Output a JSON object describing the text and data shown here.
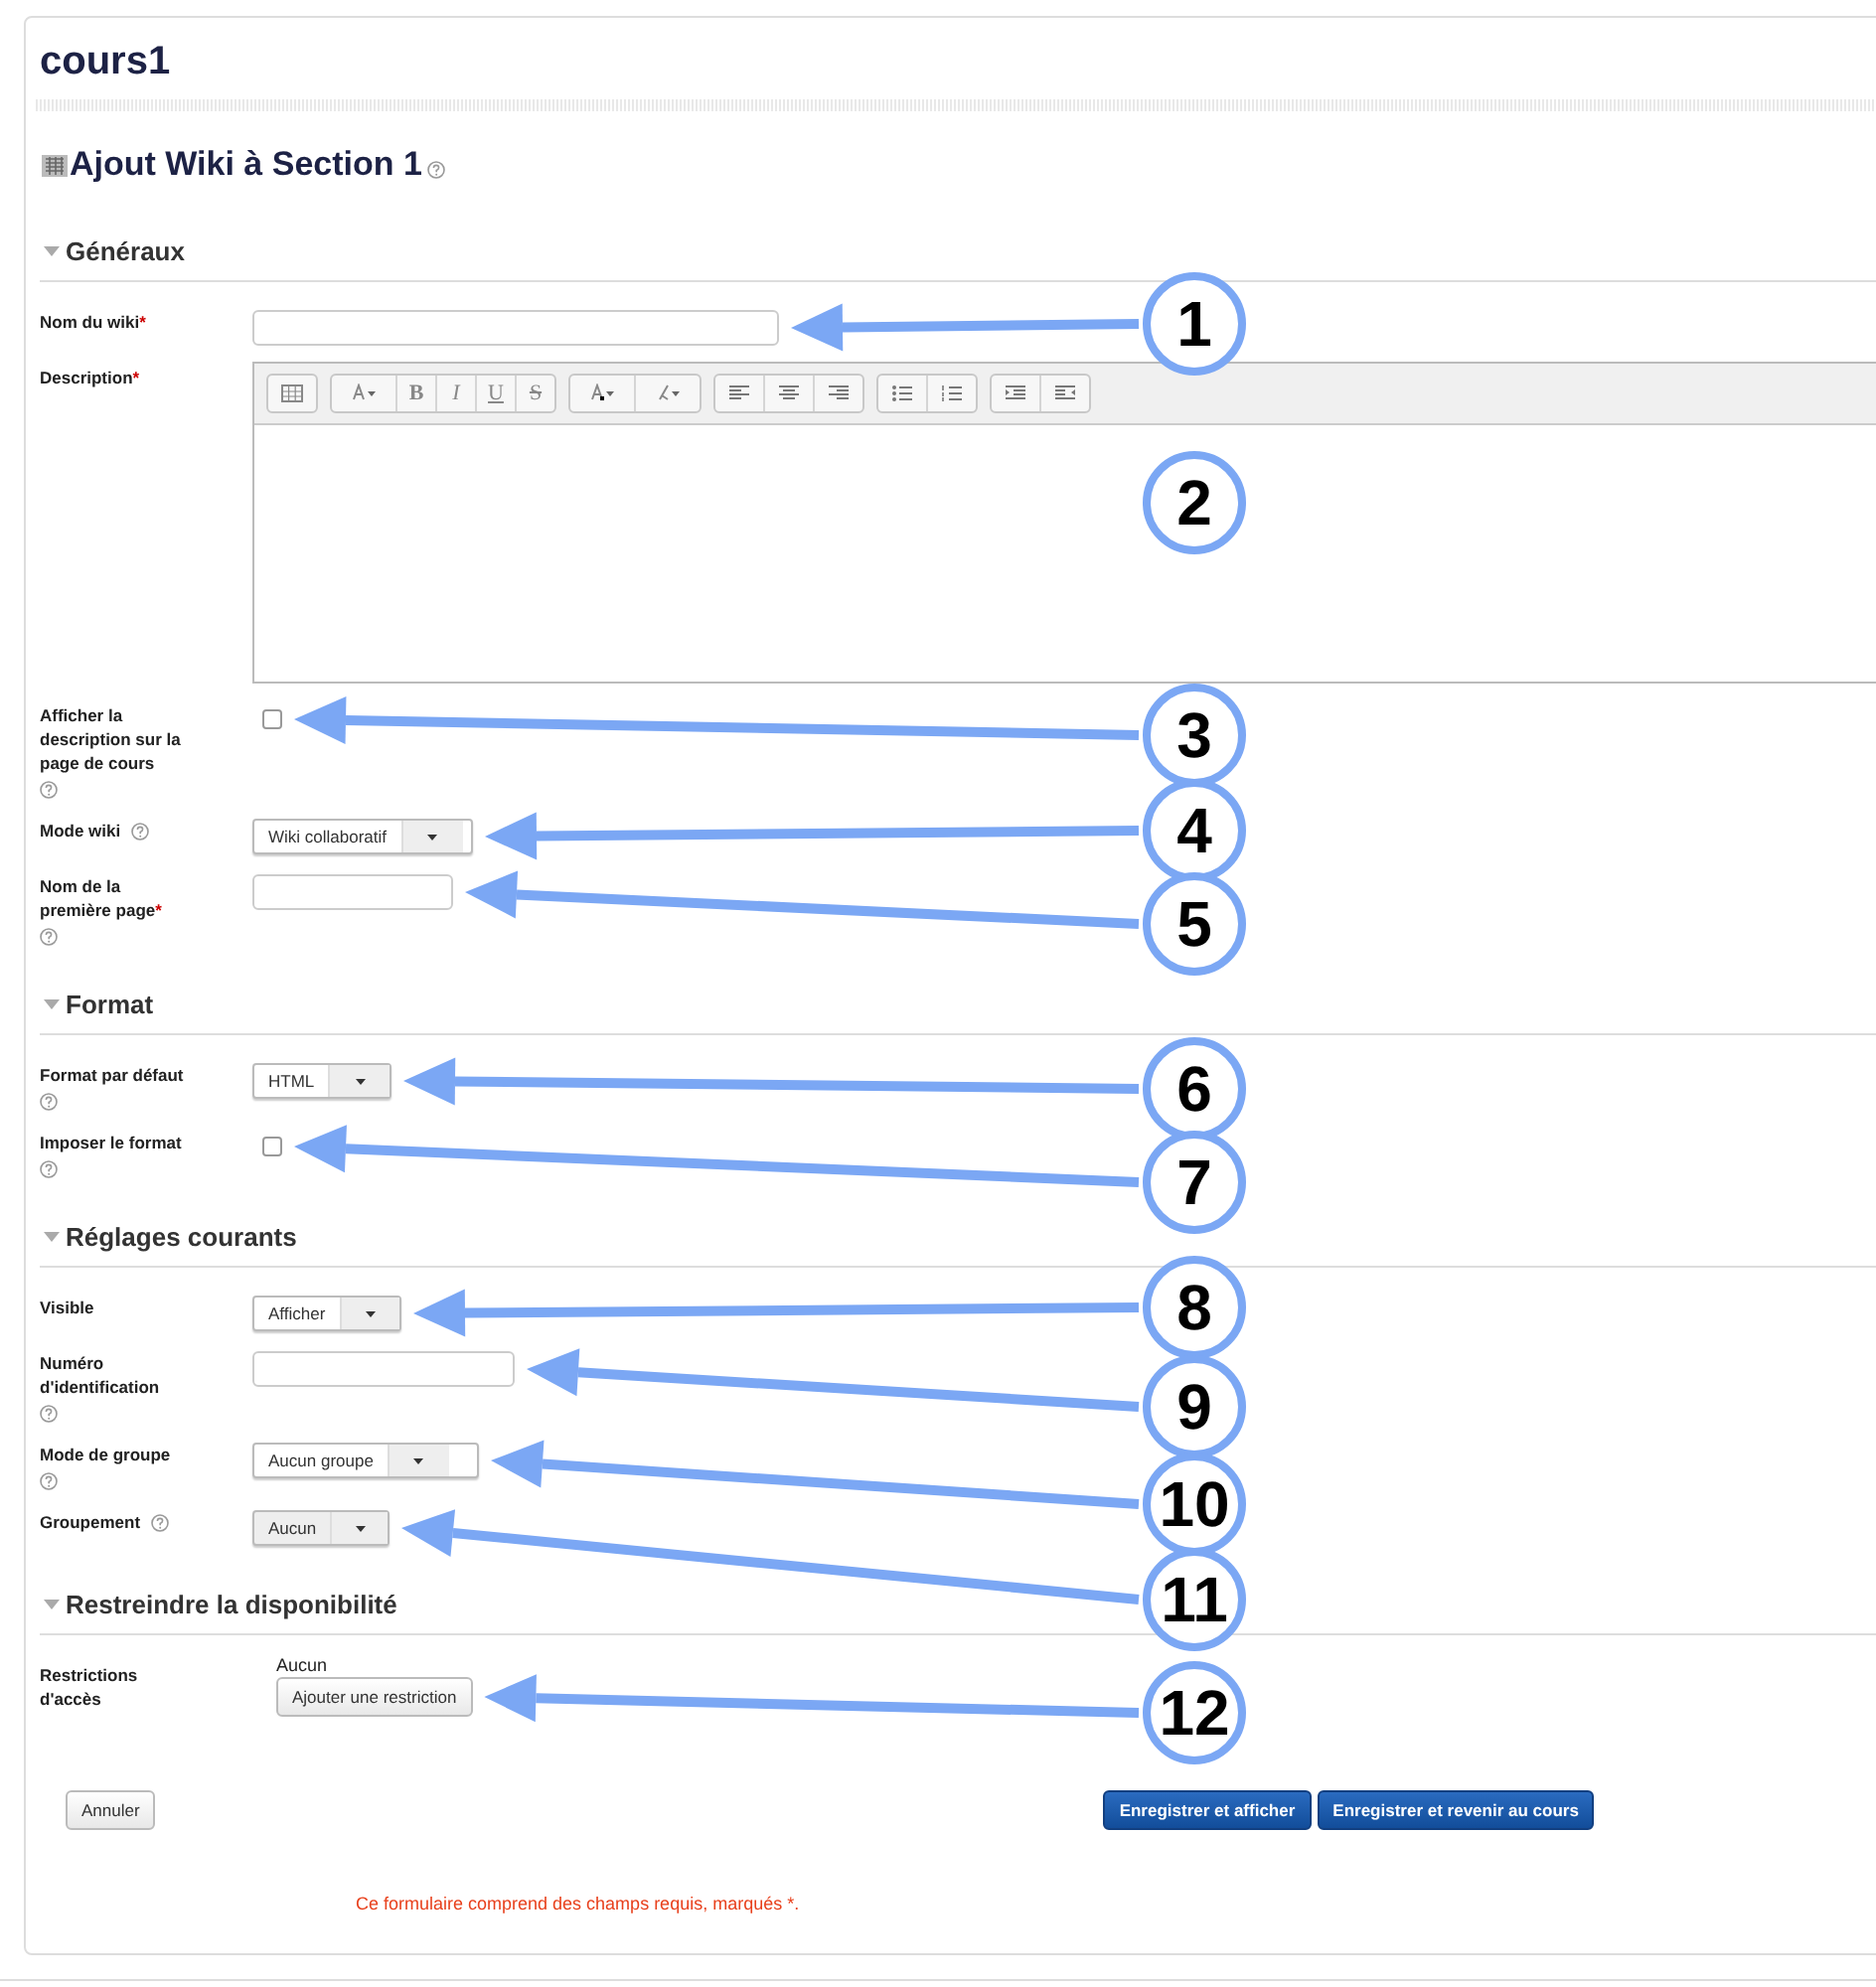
{
  "course_title": "cours1",
  "page_heading": "Ajout Wiki à Section 1",
  "sections": [
    {
      "title": "Généraux",
      "expanded": true,
      "fields": [
        {
          "kind": "text",
          "label": "Nom du wiki",
          "required_mark": "*"
        },
        {
          "kind": "editor",
          "label": "Description",
          "required_mark": "*",
          "toolbar": [
            [
              {
                "kind": "table"
              }
            ],
            [
              {
                "kind": "font"
              },
              {
                "kind": "bold",
                "label": "B"
              },
              {
                "kind": "italic",
                "label": "I"
              },
              {
                "kind": "underline",
                "label": "U"
              },
              {
                "kind": "strike",
                "label": "S"
              }
            ],
            [
              {
                "kind": "textcolor"
              },
              {
                "kind": "highlight"
              }
            ],
            [
              {
                "kind": "alignleft"
              },
              {
                "kind": "aligncenter"
              },
              {
                "kind": "alignright"
              }
            ],
            [
              {
                "kind": "bullets"
              },
              {
                "kind": "numbers"
              }
            ],
            [
              {
                "kind": "outdent"
              },
              {
                "kind": "indent"
              }
            ]
          ]
        },
        {
          "kind": "checkbox",
          "label": "Afficher la description sur la page de cours",
          "help_below": true,
          "checked": false
        },
        {
          "kind": "select",
          "label": "Mode wiki",
          "help_inline": true,
          "value": "Wiki collaboratif",
          "disabled": false
        },
        {
          "kind": "text",
          "label": "Nom de la première page",
          "required_mark": "*",
          "help_below": true
        }
      ]
    },
    {
      "title": "Format",
      "expanded": true,
      "fields": [
        {
          "kind": "select",
          "label": "Format par défaut",
          "help_below": true,
          "value": "HTML",
          "disabled": false
        },
        {
          "kind": "checkbox",
          "label": "Imposer le format",
          "help_below": true,
          "checked": false
        }
      ]
    },
    {
      "title": "Réglages courants",
      "expanded": true,
      "fields": [
        {
          "kind": "select",
          "label": "Visible",
          "value": "Afficher",
          "disabled": false
        },
        {
          "kind": "text",
          "label": "Numéro d'identification",
          "help_below": true
        },
        {
          "kind": "select",
          "label": "Mode de groupe",
          "help_below": true,
          "value": "Aucun groupe",
          "disabled": false
        },
        {
          "kind": "select",
          "label": "Groupement",
          "help_inline": true,
          "value": "Aucun",
          "disabled": true
        }
      ]
    },
    {
      "title": "Restreindre la disponibilité",
      "expanded": true,
      "fields": [
        {
          "kind": "restrictions",
          "label": "Restrictions d'accès",
          "value": "Aucun",
          "button": "Ajouter une restriction"
        }
      ]
    }
  ],
  "actions": {
    "cancel": "Annuler",
    "submit": [
      "Enregistrer et afficher",
      "Enregistrer et revenir au cours"
    ]
  },
  "required_note": "Ce formulaire comprend des champs requis, marqués *.",
  "callouts": [
    {
      "number": "1",
      "arrow": true
    },
    {
      "number": "2",
      "arrow": false
    },
    {
      "number": "3",
      "arrow": true
    },
    {
      "number": "4",
      "arrow": true
    },
    {
      "number": "5",
      "arrow": true
    },
    {
      "number": "6",
      "arrow": true
    },
    {
      "number": "7",
      "arrow": true
    },
    {
      "number": "8",
      "arrow": true
    },
    {
      "number": "9",
      "arrow": true
    },
    {
      "number": "10",
      "arrow": true
    },
    {
      "number": "11",
      "arrow": true
    },
    {
      "number": "12",
      "arrow": true
    }
  ]
}
